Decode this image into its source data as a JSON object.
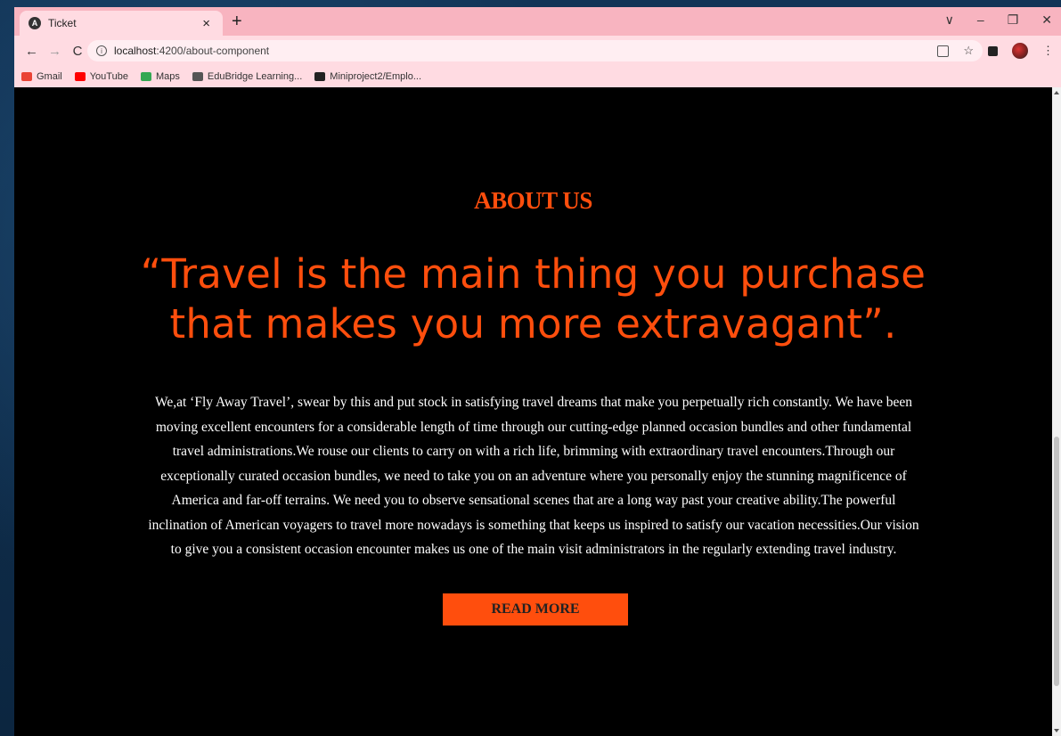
{
  "browser": {
    "tab": {
      "title": "Ticket",
      "favicon": "A"
    },
    "url": {
      "host": "localhost",
      "rest": ":4200/about-component"
    },
    "bookmarks": [
      {
        "label": "Gmail",
        "icon": "gmail-icon",
        "color": "#ea4335"
      },
      {
        "label": "YouTube",
        "icon": "youtube-icon",
        "color": "#ff0000"
      },
      {
        "label": "Maps",
        "icon": "maps-icon",
        "color": "#34a853"
      },
      {
        "label": "EduBridge Learning...",
        "icon": "edubridge-icon",
        "color": "#555555"
      },
      {
        "label": "Miniproject2/Emplo...",
        "icon": "github-icon",
        "color": "#222222"
      }
    ]
  },
  "about": {
    "title": "ABOUT US",
    "quote_line1": "“Travel is the main thing you purchase",
    "quote_line2": "that makes you more extravagant”.",
    "body": "We,at ‘Fly Away Travel’, swear by this and put stock in satisfying travel dreams that make you perpetually rich constantly. We have been moving excellent encounters for a considerable length of time through our cutting-edge planned occasion bundles and other fundamental travel administrations.We rouse our clients to carry on with a rich life, brimming with extraordinary travel encounters.Through our exceptionally curated occasion bundles, we need to take you on an adventure where you personally enjoy the stunning magnificence of America and far-off terrains. We need you to observe sensational scenes that are a long way past your creative ability.The powerful inclination of American voyagers to travel more nowadays is something that keeps us inspired to satisfy our vacation necessities.Our vision to give you a consistent occasion encounter makes us one of the main visit administrators in the regularly extending travel industry.",
    "button": "READ MORE"
  },
  "colors": {
    "accent": "#ff4e0d",
    "page_bg": "#000000",
    "chrome": "#ffdbe2"
  }
}
